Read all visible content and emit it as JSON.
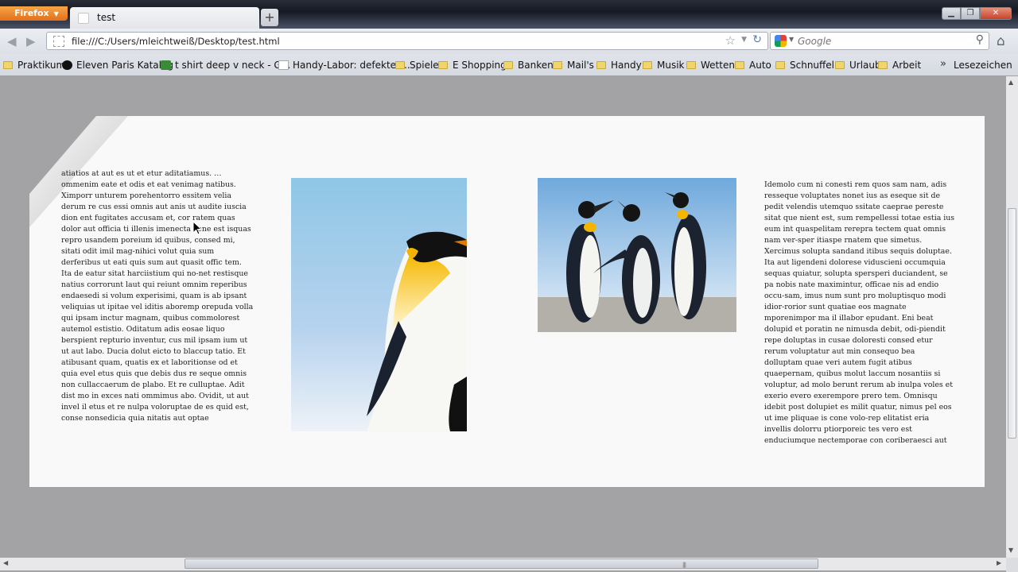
{
  "window": {
    "app_button_label": "Firefox",
    "tab_title": "test",
    "new_tab_label": "+",
    "minimize_label": "▁",
    "maximize_label": "❐",
    "close_label": "✕"
  },
  "nav": {
    "url": "file:///C:/Users/mleichtweiß/Desktop/test.html",
    "search_placeholder": "Google"
  },
  "bookmarks": {
    "items": [
      {
        "label": "Praktikum",
        "icon": "folder-icon"
      },
      {
        "label": "Eleven Paris Katalog",
        "icon": "site-icon"
      },
      {
        "label": "t shirt deep v neck - G...",
        "icon": "site-icon"
      },
      {
        "label": "Handy-Labor: defektes...",
        "icon": "page-icon"
      },
      {
        "label": "Spiele",
        "icon": "folder-icon"
      },
      {
        "label": "E Shopping",
        "icon": "folder-icon"
      },
      {
        "label": "Banken",
        "icon": "folder-icon"
      },
      {
        "label": "Mail's",
        "icon": "folder-icon"
      },
      {
        "label": "Handy",
        "icon": "folder-icon"
      },
      {
        "label": "Musik",
        "icon": "folder-icon"
      },
      {
        "label": "Wetten",
        "icon": "folder-icon"
      },
      {
        "label": "Auto",
        "icon": "folder-icon"
      },
      {
        "label": "Schnuffel",
        "icon": "folder-icon"
      },
      {
        "label": "Urlaub",
        "icon": "folder-icon"
      },
      {
        "label": "Arbeit",
        "icon": "folder-icon"
      }
    ],
    "overflow_label": "»",
    "menu_label": "Lesezeichen"
  },
  "content": {
    "col1_text": "atiatios at aut es ut et etur aditatiamus. …ommenim eate et odis et eat venimag natibus. Ximporr unturem porehentorro essitem velia derum re cus essi omnis aut anis ut audite iuscia dion ent fugitates accusam et, cor ratem quas dolor aut officia ti illenis imenecta vene est isquas repro usandem poreium id quibus, consed mi, sitati odit imil mag-nihici volut quia sum derferibus ut eati quis sum aut quasit offic tem. Ita de eatur sitat harciistium qui no-net restisque natius corrorunt laut qui reiunt omnim reperibus endaesedi si volum experisimi, quam is ab ipsant veliquias ut ipitae vel iditis aboremp orepuda volla qui ipsam inctur magnam, quibus commolorest autemol estistio. Oditatum adis eosae liquo berspient repturio inventur, cus mil ipsam ium ut ut aut labo. Ducia dolut eicto to blaccup tatio. Et atibusant quam, quatis ex et laboritionse od et quia evel etus quis que debis dus re seque omnis non cullaccaerum de plabo. Et re culluptae. Adit dist mo in exces nati ommimus abo. Ovidit, ut aut invel il etus et re nulpa voloruptae de es quid est, conse nonsedicia quia nitatis aut optae",
    "col4_text": "Idemolo cum ni conesti rem quos sam nam, adis resseque voluptates nonet ius as eseque sit de pedit velendis utemquo ssitate caeprae pereste sitat que nient est, sum rempellessi totae estia ius eum int quaspelitam rerepra tectem quat omnis nam ver-sper itiaspe rnatem que simetus. Xercimus solupta sandand itibus sequis doluptae. Ita aut ligendeni dolorese viduscieni occumquia sequas quiatur, solupta spersperi duciandent, se pa nobis nate maximintur, officae nis ad endio occu-sam, imus num sunt pro moluptisquo modi idior-rorior sunt quatiae eos magnate mporenimpor ma il illabor epudant. Eni beat dolupid et poratin ne nimusda debit, odi-piendit repe doluptas in cusae doloresti consed etur rerum voluptatur aut min consequo bea dolluptam quae veri autem fugit atibus quaepernam, quibus molut laccum nosantiis si voluptur, ad molo berunt rerum ab inulpa voles et exerio evero exerempore prero tem. Omnisqu idebit post dolupiet es milit quatur, nimus pel eos ut ime pliquae is cone volo-rep elitatist eria invellis dolorru ptiorporeic tes vero est enduciumque nectemporae con coriberaesci aut"
  },
  "colors": {
    "firefox_orange": "#e8781f",
    "page_background": "#a3a3a6",
    "paper": "#f9f9f9"
  }
}
